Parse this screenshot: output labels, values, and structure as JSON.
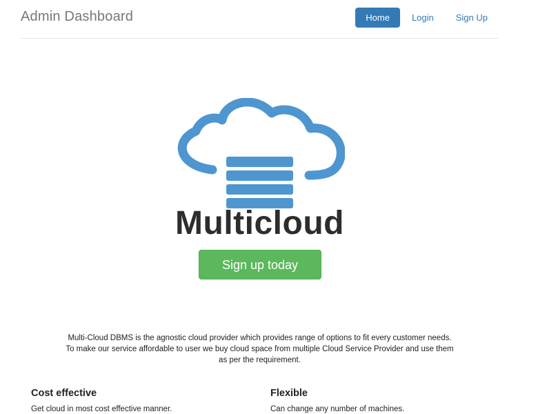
{
  "navbar": {
    "brand": "Admin Dashboard",
    "links": [
      {
        "label": "Home",
        "active": true
      },
      {
        "label": "Login",
        "active": false
      },
      {
        "label": "Sign Up",
        "active": false
      }
    ]
  },
  "hero": {
    "logo_icon": "cloud-database-icon",
    "logo_word": "Multicloud",
    "cta_label": "Sign up today",
    "colors": {
      "logo_blue": "#4f96d1",
      "cta_green": "#5cb85c",
      "nav_active": "#337ab7"
    }
  },
  "lead": {
    "lines": [
      "Multi-Cloud DBMS is the agnostic cloud provider which provides range of options to fit every customer needs.",
      "To make our service affordable to user we buy cloud space from multiple Cloud Service Provider and use them",
      "as per the requirement."
    ]
  },
  "features": [
    {
      "title": "Cost effective",
      "text": "Get cloud in most cost effective manner."
    },
    {
      "title": "Flexible",
      "text": "Can change any number of machines."
    }
  ]
}
